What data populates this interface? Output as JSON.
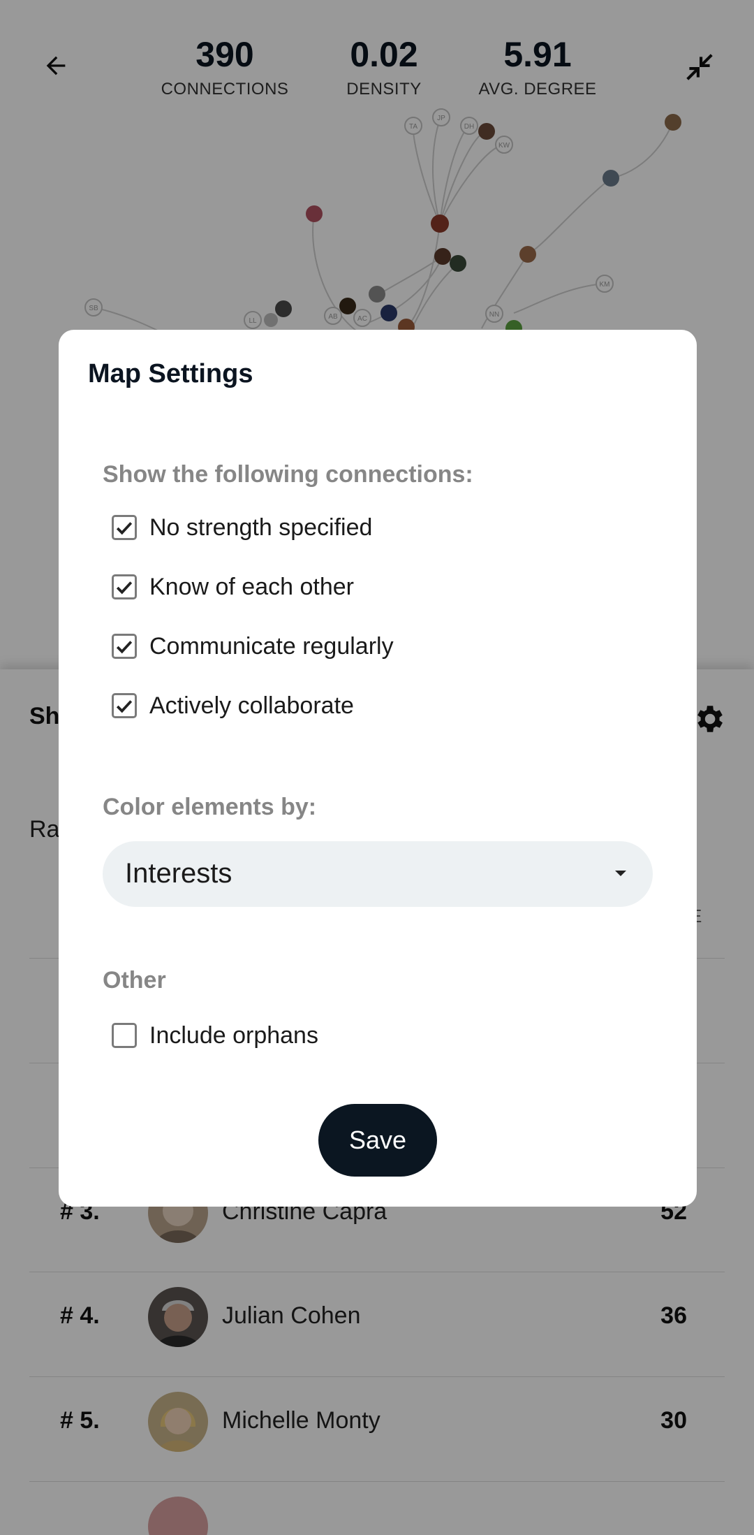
{
  "stats": {
    "connections": {
      "value": "390",
      "label": "CONNECTIONS"
    },
    "density": {
      "value": "0.02",
      "label": "DENSITY"
    },
    "avg_degree": {
      "value": "5.91",
      "label": "AVG. DEGREE"
    }
  },
  "graph": {
    "node_initials": [
      "TA",
      "JP",
      "DH",
      "KW",
      "SB",
      "LL",
      "AB",
      "AC",
      "NN",
      "KM"
    ]
  },
  "panel": {
    "title": "Sh",
    "subtitle": "Ra",
    "column_e": "E",
    "rows": [
      {
        "rank": "# 3.",
        "name": "Christine Capra",
        "score": "52"
      },
      {
        "rank": "# 4.",
        "name": "Julian Cohen",
        "score": "36"
      },
      {
        "rank": "# 5.",
        "name": "Michelle Monty",
        "score": "30"
      }
    ]
  },
  "modal": {
    "title": "Map Settings",
    "connections_heading": "Show the following connections:",
    "connection_options": [
      {
        "label": "No strength specified",
        "checked": true
      },
      {
        "label": "Know of each other",
        "checked": true
      },
      {
        "label": "Communicate regularly",
        "checked": true
      },
      {
        "label": "Actively collaborate",
        "checked": true
      }
    ],
    "color_heading": "Color elements by:",
    "color_select_value": "Interests",
    "other_heading": "Other",
    "include_orphans": {
      "label": "Include orphans",
      "checked": false
    },
    "save_label": "Save"
  },
  "colors": {
    "primary": "#0b1621",
    "section_heading": "#868686",
    "select_bg": "#edf1f3"
  }
}
